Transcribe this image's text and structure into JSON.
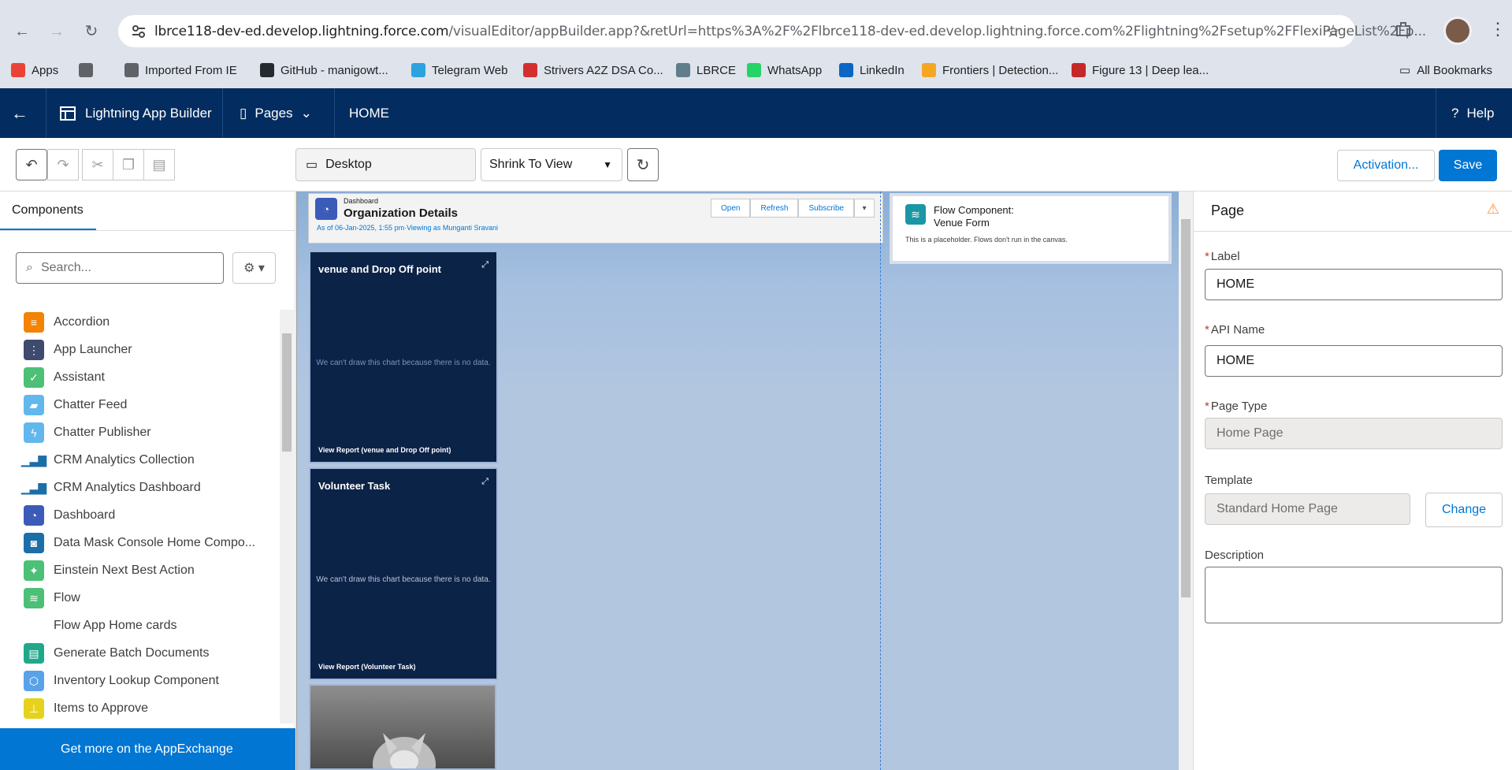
{
  "browser": {
    "url_host": "lbrce118-dev-ed.develop.lightning.force.com",
    "url_path": "/visualEditor/appBuilder.app?&retUrl=https%3A%2F%2Flbrce118-dev-ed.develop.lightning.force.com%2Flightning%2Fsetup%2FFlexiPageList%2Fp...",
    "bookmarks": [
      {
        "label": "Apps",
        "icon": "apps-grid-icon",
        "color": "#ea4335"
      },
      {
        "label": "",
        "icon": "tab-groups-icon",
        "color": "#5f6368"
      },
      {
        "label": "Imported From IE",
        "icon": "folder-icon",
        "color": "#5f6368"
      },
      {
        "label": "GitHub - manigowt...",
        "icon": "github-icon",
        "color": "#24292f"
      },
      {
        "label": "Telegram Web",
        "icon": "telegram-icon",
        "color": "#2aa3de"
      },
      {
        "label": "Strivers A2Z DSA Co...",
        "icon": "tuf-icon",
        "color": "#d32f2f"
      },
      {
        "label": "LBRCE",
        "icon": "lbrce-icon",
        "color": "#607d8b"
      },
      {
        "label": "WhatsApp",
        "icon": "whatsapp-icon",
        "color": "#25d366"
      },
      {
        "label": "LinkedIn",
        "icon": "linkedin-icon",
        "color": "#0a66c2"
      },
      {
        "label": "Frontiers | Detection...",
        "icon": "frontiers-icon",
        "color": "#f5a623"
      },
      {
        "label": "Figure 13 | Deep lea...",
        "icon": "springer-icon",
        "color": "#c62828"
      }
    ],
    "all_bookmarks": "All Bookmarks"
  },
  "header": {
    "app_name": "Lightning App Builder",
    "pages_menu": "Pages",
    "page_name": "HOME",
    "help": "Help"
  },
  "toolbar": {
    "device": "Desktop",
    "zoom": "Shrink To View",
    "activation": "Activation...",
    "save": "Save"
  },
  "left_panel": {
    "tab": "Components",
    "search_placeholder": "Search...",
    "components": [
      {
        "label": "Accordion",
        "color": "#f38303",
        "glyph": "≡"
      },
      {
        "label": "App Launcher",
        "color": "#3e4a6e",
        "glyph": "⋮⋮⋮"
      },
      {
        "label": "Assistant",
        "color": "#4bc076",
        "glyph": "✓"
      },
      {
        "label": "Chatter Feed",
        "color": "#62b7ed",
        "glyph": "▰"
      },
      {
        "label": "Chatter Publisher",
        "color": "#62b7ed",
        "glyph": "ϟ"
      },
      {
        "label": "CRM Analytics Collection",
        "color": "#ffffff",
        "glyph": "▁▃▇"
      },
      {
        "label": "CRM Analytics Dashboard",
        "color": "#ffffff",
        "glyph": "▁▃▇"
      },
      {
        "label": "Dashboard",
        "color": "#3b5bb8",
        "glyph": "◔"
      },
      {
        "label": "Data Mask Console Home Compo...",
        "color": "#1b6ea8",
        "glyph": "◙"
      },
      {
        "label": "Einstein Next Best Action",
        "color": "#4bc076",
        "glyph": "✦"
      },
      {
        "label": "Flow",
        "color": "#4bc076",
        "glyph": "≋"
      },
      {
        "label": "Flow App Home cards",
        "color": "#ffffff",
        "glyph": ""
      },
      {
        "label": "Generate Batch Documents",
        "color": "#21a88b",
        "glyph": "▤"
      },
      {
        "label": "Inventory Lookup Component",
        "color": "#5aa2e8",
        "glyph": "⬡"
      },
      {
        "label": "Items to Approve",
        "color": "#e6d21d",
        "glyph": "⊥"
      }
    ],
    "appexchange": "Get more on the AppExchange"
  },
  "canvas": {
    "dashboard": {
      "label": "Dashboard",
      "title": "Organization Details",
      "subtitle": "As of 06-Jan-2025, 1:55 pm·Viewing as Munganti Sravani",
      "actions": [
        "Open",
        "Refresh",
        "Subscribe"
      ]
    },
    "chart1": {
      "title": "venue and Drop Off point",
      "message": "We can't draw this chart because there is no data.",
      "footer": "View Report (venue and Drop Off point)"
    },
    "chart2": {
      "title": "Volunteer Task",
      "message": "We can't draw this chart because there is no data.",
      "footer": "View Report (Volunteer Task)"
    },
    "flow": {
      "title_line1": "Flow Component:",
      "title_line2": "Venue Form",
      "note": "This is a placeholder. Flows don't run in the canvas."
    }
  },
  "right_panel": {
    "title": "Page",
    "label_label": "Label",
    "label_value": "HOME",
    "api_label": "API Name",
    "api_value": "HOME",
    "type_label": "Page Type",
    "type_value": "Home Page",
    "template_label": "Template",
    "template_value": "Standard Home Page",
    "change": "Change",
    "description_label": "Description"
  }
}
